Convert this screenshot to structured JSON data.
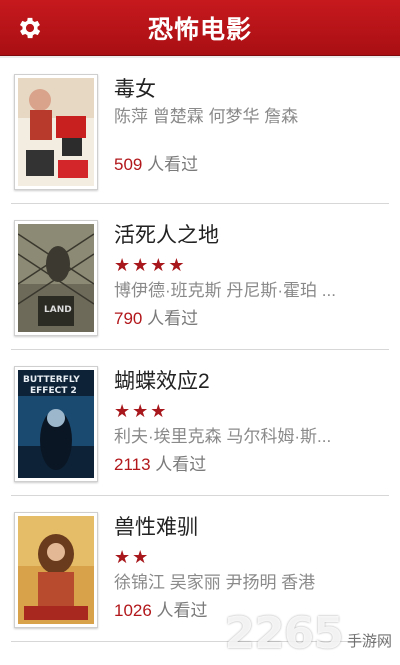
{
  "header": {
    "title": "恐怖电影",
    "settings_icon": "gear-icon"
  },
  "movies": [
    {
      "title": "毒女",
      "stars": "",
      "cast": "陈萍 曾楚霖 何梦华 詹森",
      "views_num": "509",
      "views_suffix": " 人看过"
    },
    {
      "title": "活死人之地",
      "stars": "★★★★",
      "cast": "博伊德·班克斯 丹尼斯·霍珀 ...",
      "views_num": "790",
      "views_suffix": " 人看过"
    },
    {
      "title": "蝴蝶效应2",
      "stars": "★★★",
      "cast": "利夫·埃里克森 马尔科姆·斯...",
      "views_num": "2113",
      "views_suffix": " 人看过"
    },
    {
      "title": "兽性难驯",
      "stars": "★★",
      "cast": "徐锦江 吴家丽 尹扬明 香港",
      "views_num": "1026",
      "views_suffix": " 人看过"
    }
  ],
  "watermark": {
    "number": "2265",
    "text": "手游网"
  },
  "colors": {
    "header": "#b71418",
    "accent": "#a7171b"
  }
}
